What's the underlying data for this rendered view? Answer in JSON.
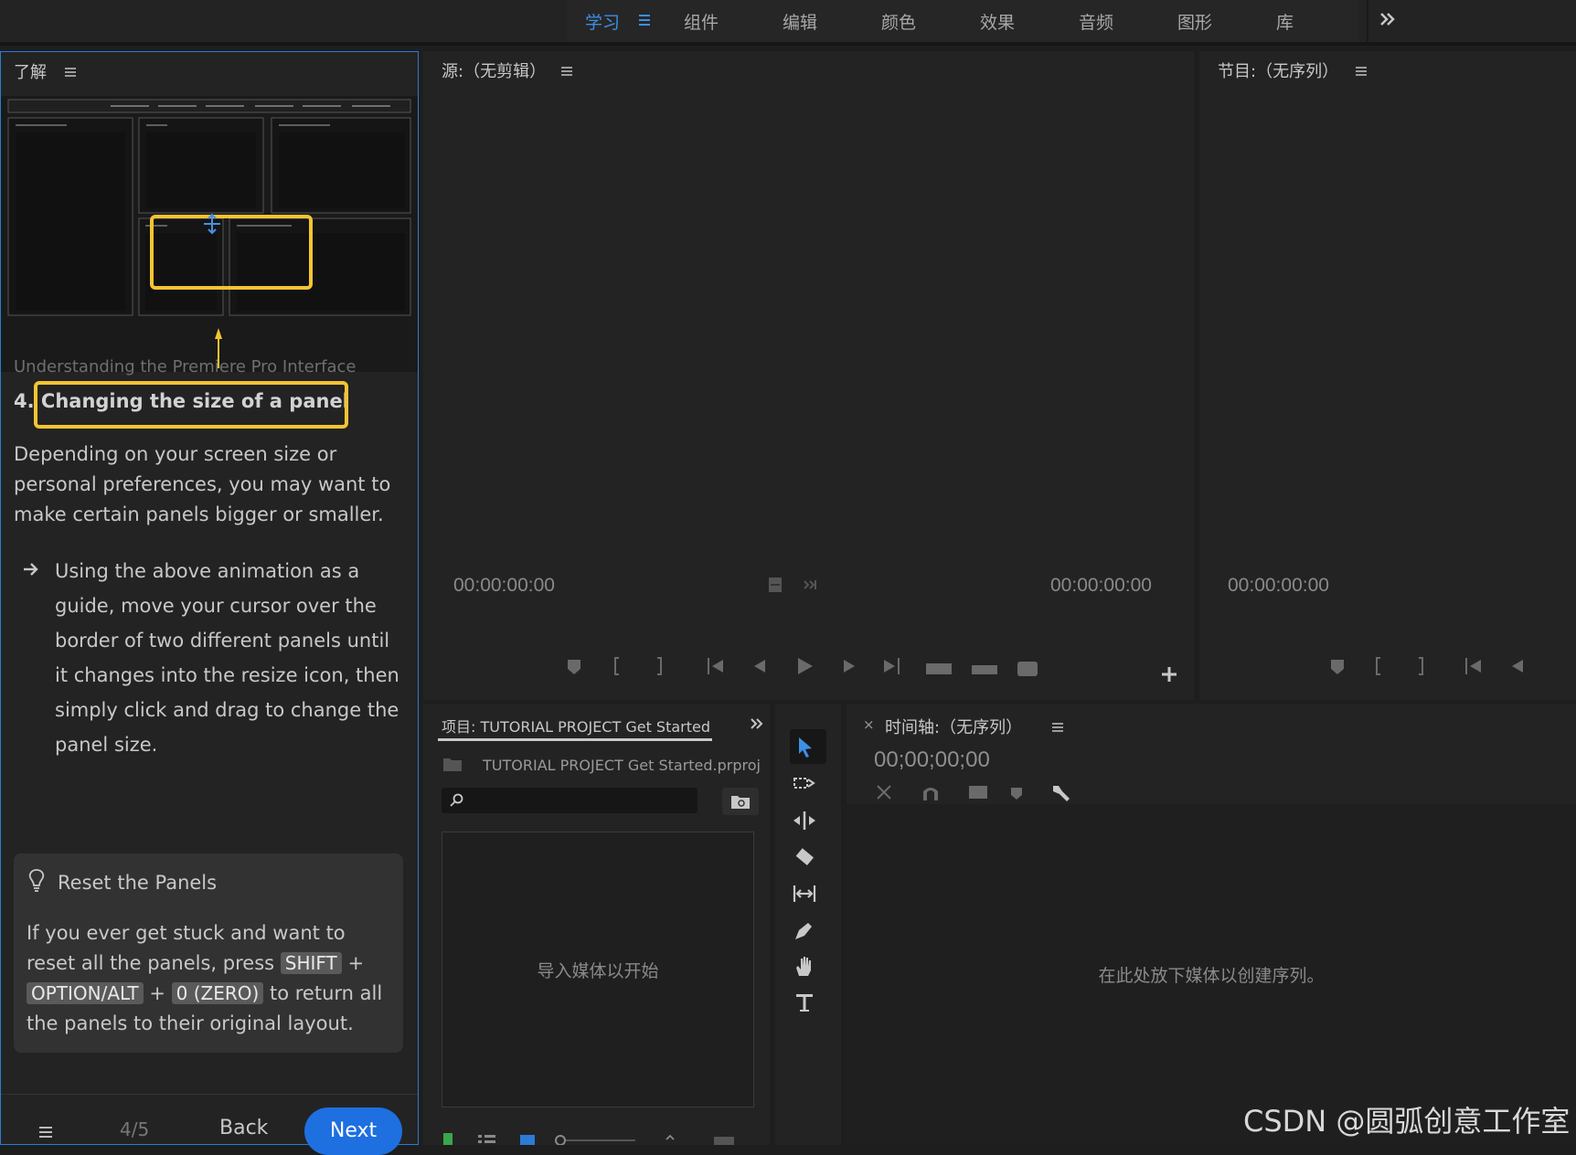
{
  "workspace": {
    "tabs": [
      "学习",
      "组件",
      "编辑",
      "颜色",
      "效果",
      "音频",
      "图形",
      "库"
    ],
    "active_tab": "学习"
  },
  "learn": {
    "panel_title": "了解",
    "subtitle": "Understanding the Premiere Pro Interface",
    "step_number": "4.",
    "heading": "Changing the size of a panel",
    "description": "Depending on your screen size or personal preferences, you may want to make certain panels bigger or smaller.",
    "step_text": "Using the above animation as a guide, move your cursor over the border of two different panels until it changes into the resize icon, then simply click and drag to change the panel size.",
    "tip": {
      "title": "Reset the Panels",
      "text_1": "If you ever get stuck and want to reset all the panels, press",
      "key_1": "SHIFT",
      "plus_1": "+",
      "key_2": "OPTION/ALT",
      "plus_2": "+",
      "key_3": "0 (ZERO)",
      "text_2": "to return all the panels to their original layout."
    },
    "page_indicator": "4/5",
    "back_label": "Back",
    "next_label": "Next",
    "highlight_color": "#f4c431"
  },
  "source": {
    "title": "源:（无剪辑）",
    "timecode_in": "00:00:00:00",
    "timecode_out": "00:00:00:00"
  },
  "program": {
    "title": "节目:（无序列）",
    "timecode": "00:00:00:00"
  },
  "project": {
    "title": "项目: TUTORIAL PROJECT Get Started",
    "file": "TUTORIAL PROJECT Get Started.prproj",
    "empty_text": "导入媒体以开始"
  },
  "timeline": {
    "close": "×",
    "title": "时间轴:（无序列）",
    "timecode": "00;00;00;00",
    "empty_text": "在此处放下媒体以创建序列。"
  },
  "watermark": "CSDN @圆弧创意工作室",
  "colors": {
    "accent": "#2d7bd4",
    "next_button": "#1e6fe0",
    "highlight": "#f4c431"
  }
}
